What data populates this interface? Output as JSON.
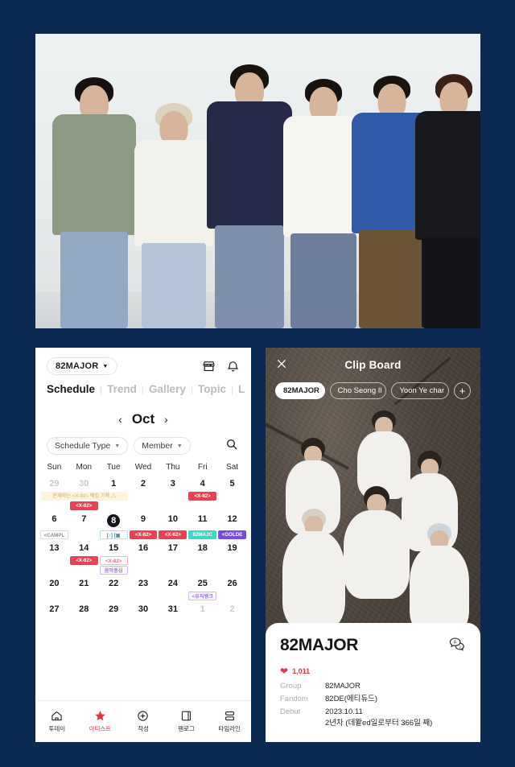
{
  "theme": {
    "background": "#0b2a52",
    "accent_red": "#e8324a",
    "teal": "#3fd6c5",
    "purple": "#7b4ae0"
  },
  "hero": {
    "alt": "82MAJOR six member group photo"
  },
  "left_app": {
    "group_chip": {
      "label": "82MAJOR",
      "caret": "chevron-down-icon"
    },
    "header_icons": [
      {
        "name": "store-icon"
      },
      {
        "name": "bell-icon"
      }
    ],
    "tabs": [
      {
        "label": "Schedule",
        "active": true
      },
      {
        "label": "Trend",
        "active": false
      },
      {
        "label": "Gallery",
        "active": false
      },
      {
        "label": "Topic",
        "active": false
      },
      {
        "label": "L",
        "active": false
      }
    ],
    "month": {
      "prev": "‹",
      "name": "Oct",
      "next": "›"
    },
    "filters": [
      {
        "label": "Schedule Type"
      },
      {
        "label": "Member"
      }
    ],
    "search_icon": "search-icon",
    "dow": [
      "Sun",
      "Mon",
      "Tue",
      "Wed",
      "Thu",
      "Fri",
      "Sat"
    ],
    "weeks": [
      {
        "days": [
          {
            "num": "29",
            "muted": true
          },
          {
            "num": "30",
            "muted": true
          },
          {
            "num": "1",
            "muted": false
          },
          {
            "num": "2",
            "muted": false
          },
          {
            "num": "3",
            "muted": false
          },
          {
            "num": "4",
            "muted": false
          },
          {
            "num": "5",
            "muted": false
          }
        ],
        "event_rows": [
          [
            {
              "col": 0,
              "span": 3,
              "label": "존재하는 <X-82> 팩킹 기록 △",
              "style": "cream"
            },
            {
              "col": 3,
              "span": 1,
              "label": "<X-82>",
              "style": "red"
            }
          ],
          [
            {
              "col": 1,
              "span": 1,
              "label": "<X-82>",
              "style": "red"
            }
          ]
        ]
      },
      {
        "days": [
          {
            "num": "6",
            "muted": false
          },
          {
            "num": "7",
            "muted": false
          },
          {
            "num": "8",
            "muted": false,
            "today": true
          },
          {
            "num": "9",
            "muted": false
          },
          {
            "num": "10",
            "muted": false
          },
          {
            "num": "11",
            "muted": false
          },
          {
            "num": "12",
            "muted": false
          }
        ],
        "event_rows": [
          [
            {
              "col": 0,
              "span": 1,
              "label": "<CAMPL",
              "style": "greyout"
            },
            {
              "col": 1,
              "span": 1,
              "label": "",
              "style": "none"
            },
            {
              "col": 2,
              "span": 1,
              "label": "[♪] [▣",
              "style": "cyanout"
            },
            {
              "col": 3,
              "span": 1,
              "label": "<X-82>",
              "style": "red"
            },
            {
              "col": 4,
              "span": 1,
              "label": "<X-82>",
              "style": "red"
            },
            {
              "col": 5,
              "span": 1,
              "label": "82MAJC",
              "style": "teal"
            },
            {
              "col": 6,
              "span": 1,
              "label": "<GOLDE",
              "style": "purple"
            }
          ]
        ]
      },
      {
        "days": [
          {
            "num": "13",
            "muted": false
          },
          {
            "num": "14",
            "muted": false
          },
          {
            "num": "15",
            "muted": false
          },
          {
            "num": "16",
            "muted": false
          },
          {
            "num": "17",
            "muted": false
          },
          {
            "num": "18",
            "muted": false
          },
          {
            "num": "19",
            "muted": false
          }
        ],
        "event_rows": [
          [
            {
              "col": 1,
              "span": 1,
              "label": "<X-82>",
              "style": "red"
            },
            {
              "col": 2,
              "span": 1,
              "label": "<X-82>",
              "style": "pinkout"
            }
          ],
          [
            {
              "col": 2,
              "span": 1,
              "label": "음악중심",
              "style": "violetout"
            }
          ]
        ]
      },
      {
        "days": [
          {
            "num": "20",
            "muted": false
          },
          {
            "num": "21",
            "muted": false
          },
          {
            "num": "22",
            "muted": false
          },
          {
            "num": "23",
            "muted": false
          },
          {
            "num": "24",
            "muted": false
          },
          {
            "num": "25",
            "muted": false
          },
          {
            "num": "26",
            "muted": false
          }
        ],
        "event_rows": [
          [
            {
              "col": 5,
              "span": 1,
              "label": "<유직뱅크",
              "style": "violetout"
            }
          ]
        ]
      },
      {
        "days": [
          {
            "num": "27",
            "muted": false
          },
          {
            "num": "28",
            "muted": false
          },
          {
            "num": "29",
            "muted": false
          },
          {
            "num": "30",
            "muted": false
          },
          {
            "num": "31",
            "muted": false
          },
          {
            "num": "1",
            "muted": true
          },
          {
            "num": "2",
            "muted": true
          }
        ],
        "event_rows": []
      }
    ],
    "bottom_nav": [
      {
        "label": "투데이",
        "icon": "home-icon",
        "active": false
      },
      {
        "label": "아티스트",
        "icon": "star-icon",
        "active": true
      },
      {
        "label": "작성",
        "icon": "plus-circle-icon",
        "active": false
      },
      {
        "label": "팬로그",
        "icon": "book-icon",
        "active": false
      },
      {
        "label": "타임라인",
        "icon": "timeline-icon",
        "active": false
      }
    ]
  },
  "right_app": {
    "close_icon": "close-icon",
    "title": "Clip Board",
    "chips": [
      {
        "label": "82MAJOR",
        "selected": true
      },
      {
        "label": "Cho Seong Il",
        "selected": false
      },
      {
        "label": "Yoon Ye char",
        "selected": false
      }
    ],
    "add_button": {
      "label": "+",
      "icon": "plus-icon"
    },
    "card": {
      "title": "82MAJOR",
      "translate_icon": "translate-chat-icon",
      "heart_icon": "heart-icon",
      "like_count": "1,011",
      "meta": [
        {
          "key": "Group",
          "value": "82MAJOR"
        },
        {
          "key": "Fandom",
          "value": "82DE(에티듀드)"
        },
        {
          "key": "Debut",
          "value": "2023.10.11",
          "sub": "2년차 (데뫝ed일로부터 366일 째)"
        }
      ]
    }
  }
}
